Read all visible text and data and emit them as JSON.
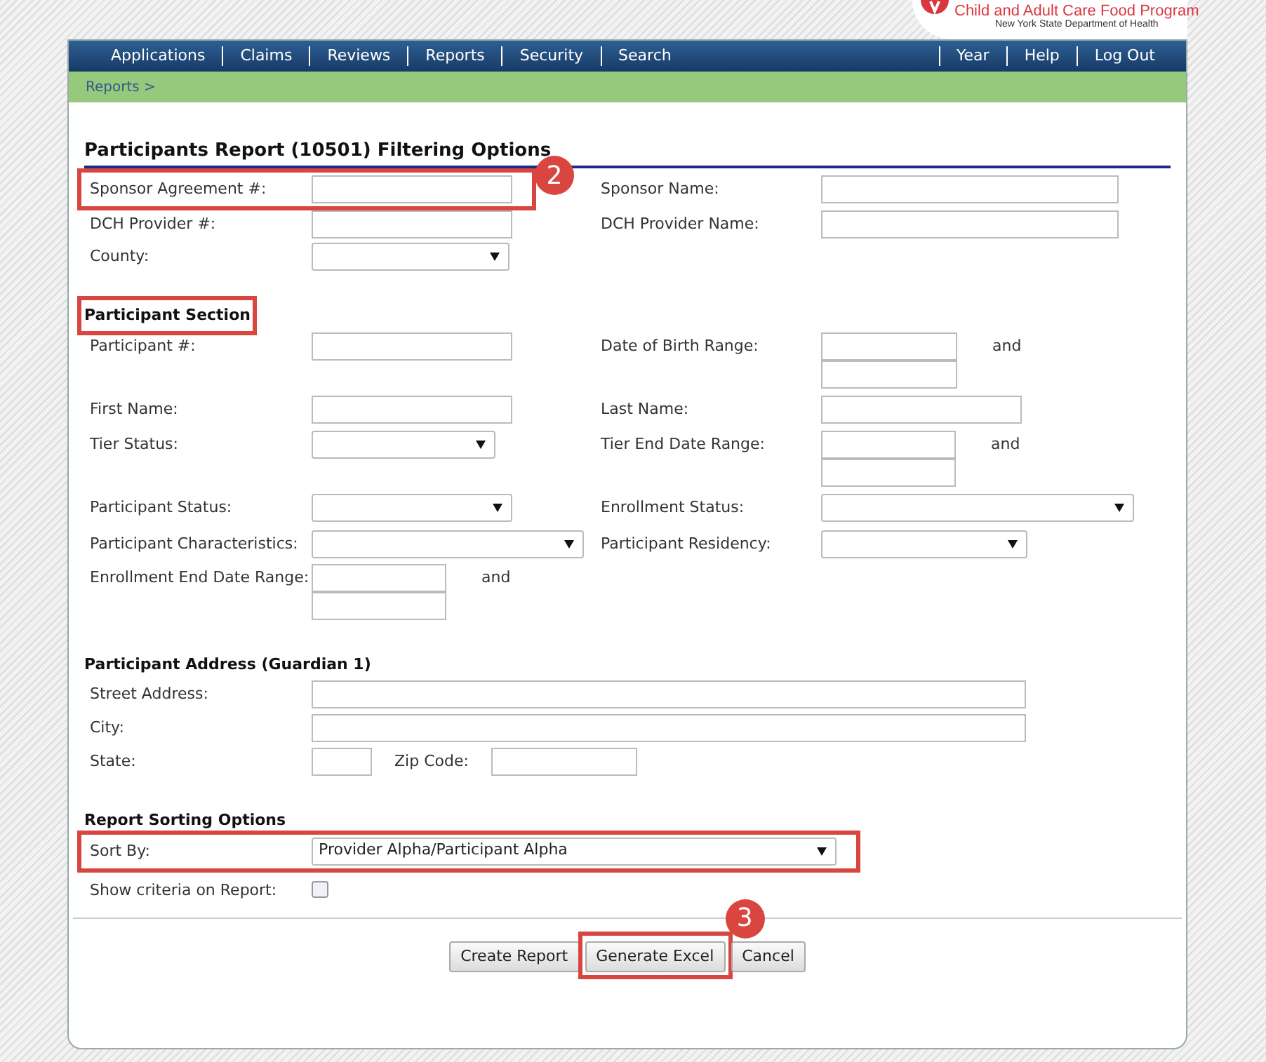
{
  "brand": {
    "title": "Child and Adult Care Food Program",
    "subtitle": "New York State Department of Health"
  },
  "nav": {
    "left": [
      "Applications",
      "Claims",
      "Reviews",
      "Reports",
      "Security",
      "Search"
    ],
    "right": [
      "Year",
      "Help",
      "Log Out"
    ]
  },
  "breadcrumb": "Reports >",
  "title": "Participants Report (10501) Filtering Options",
  "sections": [
    {
      "rows": [
        {
          "left": {
            "label": "Sponsor Agreement #:",
            "controls": [
              {
                "kind": "text"
              }
            ],
            "highlighted": true,
            "callout": "2"
          },
          "right": {
            "label": "Sponsor Name:",
            "controls": [
              {
                "kind": "text"
              }
            ]
          }
        },
        {
          "left": {
            "label": "DCH Provider #:",
            "controls": [
              {
                "kind": "text"
              }
            ]
          },
          "right": {
            "label": "DCH Provider Name:",
            "controls": [
              {
                "kind": "text"
              }
            ]
          }
        },
        {
          "left": {
            "label": "County:",
            "controls": [
              {
                "kind": "select"
              }
            ]
          }
        }
      ]
    },
    {
      "heading": "Participant Section",
      "highlighted": true,
      "rows": [
        {
          "left": {
            "label": "Participant #:",
            "controls": [
              {
                "kind": "text"
              }
            ]
          },
          "right": {
            "label": "Date of Birth Range:",
            "controls": [
              {
                "kind": "range",
                "and": "and"
              }
            ]
          }
        },
        {
          "left": {
            "label": "First Name:",
            "controls": [
              {
                "kind": "text"
              }
            ]
          },
          "right": {
            "label": "Last Name:",
            "controls": [
              {
                "kind": "text"
              }
            ]
          }
        },
        {
          "left": {
            "label": "Tier Status:",
            "controls": [
              {
                "kind": "select"
              }
            ]
          },
          "right": {
            "label": "Tier End Date Range:",
            "controls": [
              {
                "kind": "range",
                "and": "and"
              }
            ]
          }
        },
        {
          "left": {
            "label": "Participant Status:",
            "controls": [
              {
                "kind": "select"
              }
            ]
          },
          "right": {
            "label": "Enrollment Status:",
            "controls": [
              {
                "kind": "select"
              }
            ]
          }
        },
        {
          "left": {
            "label": "Participant Characteristics:",
            "controls": [
              {
                "kind": "select"
              }
            ]
          },
          "right": {
            "label": "Participant Residency:",
            "controls": [
              {
                "kind": "select"
              }
            ]
          }
        },
        {
          "left": {
            "label": "Enrollment End Date Range:",
            "controls": [
              {
                "kind": "range",
                "and": "and"
              }
            ]
          }
        }
      ]
    },
    {
      "heading": "Participant Address (Guardian 1)",
      "highlighted": false,
      "rows": [
        {
          "left": {
            "label": "Street Address:",
            "controls": [
              {
                "kind": "text"
              }
            ]
          }
        },
        {
          "left": {
            "label": "City:",
            "controls": [
              {
                "kind": "text"
              }
            ]
          }
        },
        {
          "left": {
            "label": "State:",
            "controls": [
              {
                "kind": "text"
              },
              {
                "kind": "label",
                "text": "Zip Code:"
              },
              {
                "kind": "text"
              }
            ]
          }
        }
      ]
    },
    {
      "heading": "Report Sorting Options",
      "highlighted": false,
      "rows": [
        {
          "left": {
            "label": "Sort By:",
            "controls": [
              {
                "kind": "select",
                "value": "Provider Alpha/Participant Alpha"
              }
            ],
            "highlighted": true
          }
        },
        {
          "left": {
            "label": "Show criteria on Report:",
            "controls": [
              {
                "kind": "checkbox",
                "checked": false
              }
            ]
          }
        }
      ]
    }
  ],
  "buttons": [
    {
      "label": "Create Report",
      "highlighted": false
    },
    {
      "label": "Generate Excel",
      "highlighted": true,
      "callout": "3"
    },
    {
      "label": "Cancel",
      "highlighted": false
    }
  ]
}
